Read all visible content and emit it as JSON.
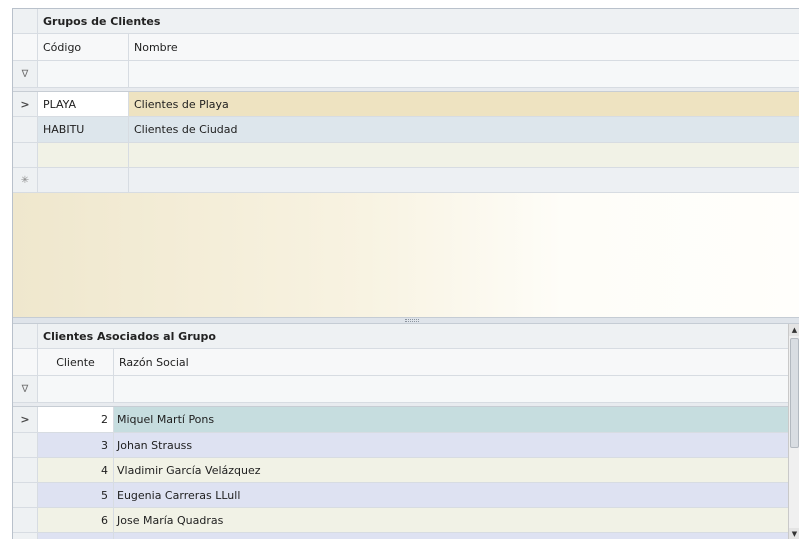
{
  "top_panel": {
    "title": "Grupos de Clientes",
    "columns": [
      "Código",
      "Nombre"
    ],
    "filter_icon": "funnel-icon",
    "rows": [
      {
        "codigo": "PLAYA",
        "nombre": "Clientes de Playa",
        "selected": true
      },
      {
        "codigo": "HABITU",
        "nombre": "Clientes de Ciudad",
        "selected": false
      },
      {
        "codigo": "",
        "nombre": "",
        "selected": false
      }
    ],
    "new_row_icon": "new-row-star-icon",
    "current_row_icon": "current-row-arrow-icon"
  },
  "bottom_panel": {
    "title": "Clientes Asociados al Grupo",
    "columns": [
      "Cliente",
      "Razón Social"
    ],
    "rows": [
      {
        "cliente": "2",
        "razon": "Miquel Martí Pons",
        "selected": true
      },
      {
        "cliente": "3",
        "razon": "Johan Strauss",
        "selected": false
      },
      {
        "cliente": "4",
        "razon": "Vladimir García Velázquez",
        "selected": false
      },
      {
        "cliente": "5",
        "razon": "Eugenia Carreras LLull",
        "selected": false
      },
      {
        "cliente": "6",
        "razon": "Jose María Quadras",
        "selected": false
      }
    ]
  },
  "glyphs": {
    "arrow": ">",
    "filter": "∇",
    "star": "✳",
    "scroll_up": "▲",
    "scroll_down": "▼"
  },
  "colors": {
    "selected_row": "#eee3c1",
    "alt_row": "#dde6ec",
    "selected_row_bottom": "#c6dddf",
    "band_a": "#f1f2e6",
    "band_b": "#dee2f2"
  }
}
